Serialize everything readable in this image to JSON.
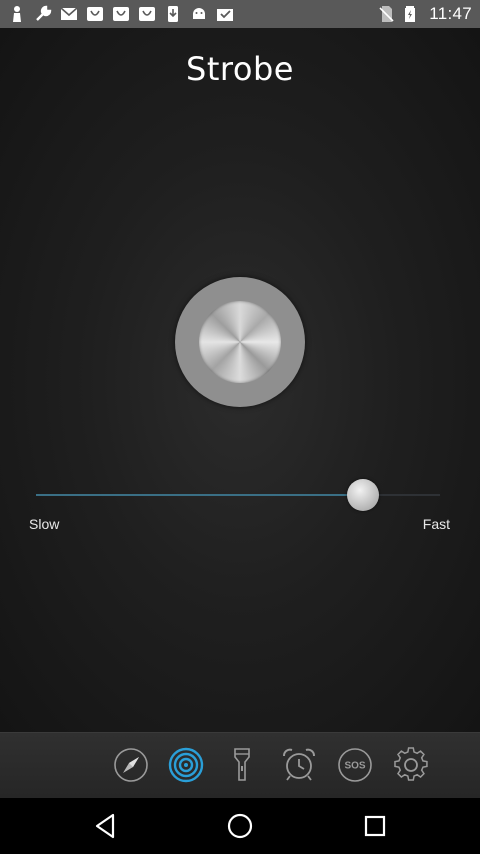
{
  "status_bar": {
    "time": "11:47",
    "left_icons": [
      "person-icon",
      "wrench-icon",
      "gmail-icon",
      "app-icon",
      "app-icon",
      "app-icon",
      "phone-download-icon",
      "android-icon",
      "inbox-check-icon"
    ],
    "right_icons": [
      "no-sim-icon",
      "battery-charging-icon"
    ]
  },
  "header": {
    "title": "Strobe"
  },
  "strobe": {
    "button_icon": "strobe-knob"
  },
  "slider": {
    "min_label": "Slow",
    "max_label": "Fast",
    "value": 0.81,
    "accent": "#3a6f85"
  },
  "toolbar": {
    "items": [
      {
        "name": "compass",
        "icon": "compass-icon",
        "active": false
      },
      {
        "name": "strobe",
        "icon": "strobe-rings-icon",
        "active": true
      },
      {
        "name": "flashlight",
        "icon": "flashlight-icon",
        "active": false
      },
      {
        "name": "alarm",
        "icon": "alarm-clock-icon",
        "active": false
      },
      {
        "name": "sos",
        "icon": "sos-icon",
        "label": "SOS",
        "active": false
      },
      {
        "name": "settings",
        "icon": "gear-icon",
        "active": false
      }
    ],
    "active_color": "#2a9fd8",
    "inactive_color": "#9a9a9a"
  },
  "navbar": {
    "buttons": [
      "back-icon",
      "home-icon",
      "recents-icon"
    ]
  }
}
